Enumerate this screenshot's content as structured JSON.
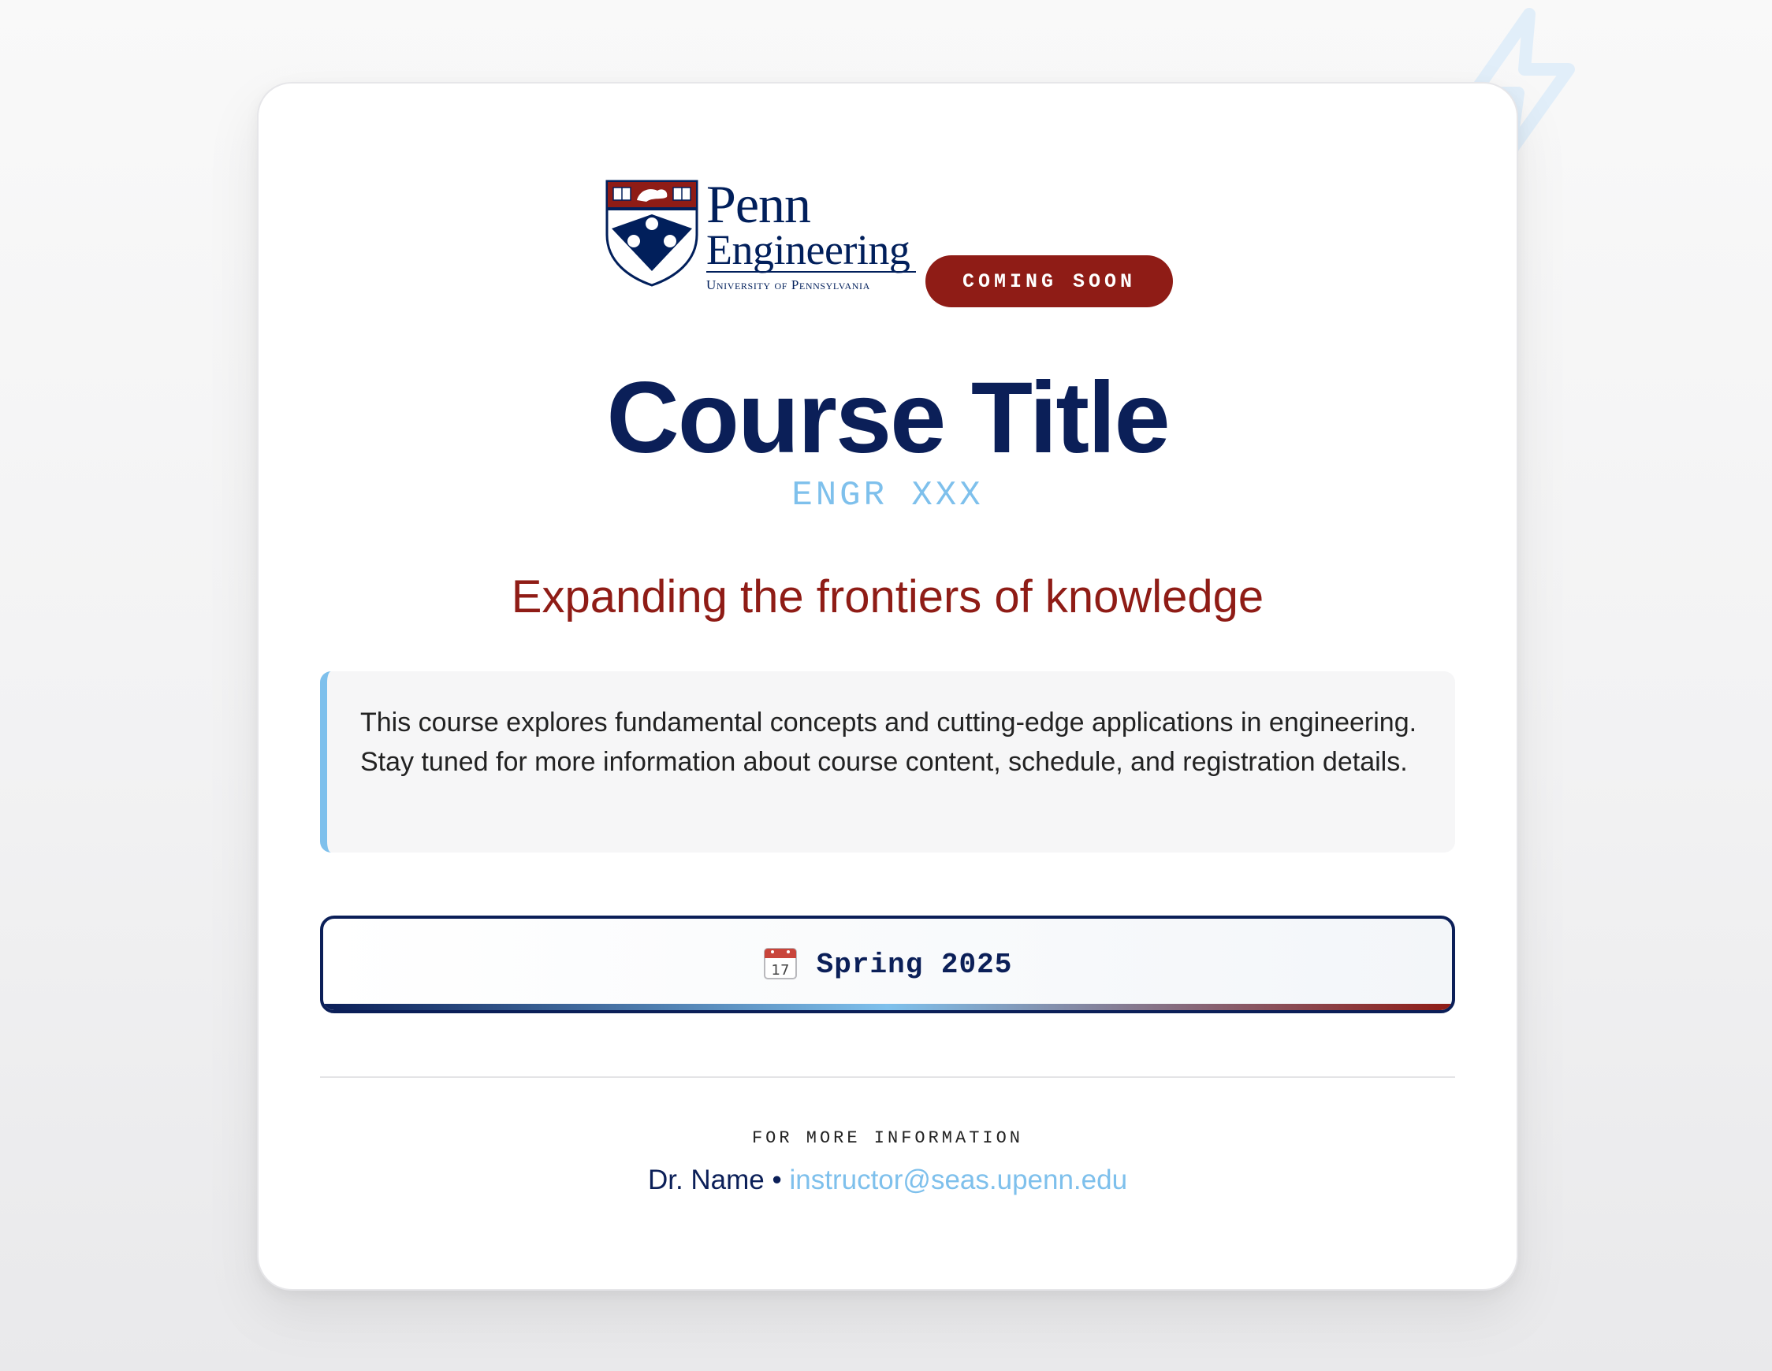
{
  "colors": {
    "navy": "#0b1f58",
    "red": "#8f1c16",
    "light_blue": "#7ec0ec",
    "panel": "#f6f6f7"
  },
  "decoration": {
    "icon": "lightning-bolt-icon"
  },
  "logo": {
    "line1": "Penn",
    "line2": "Engineering",
    "line3": "University of Pennsylvania"
  },
  "badge": {
    "label": "COMING SOON"
  },
  "course": {
    "title": "Course Title",
    "code": "ENGR XXX",
    "tagline": "Expanding the frontiers of knowledge",
    "description": "This course explores fundamental concepts and cutting-edge applications in engineering. Stay tuned for more information about course content, schedule, and registration details."
  },
  "term": {
    "icon": "calendar-icon",
    "calendar_day": "17",
    "label": "Spring 2025"
  },
  "footer": {
    "heading": "FOR MORE INFORMATION",
    "instructor": "Dr. Name",
    "separator": "•",
    "email": "instructor@seas.upenn.edu"
  }
}
